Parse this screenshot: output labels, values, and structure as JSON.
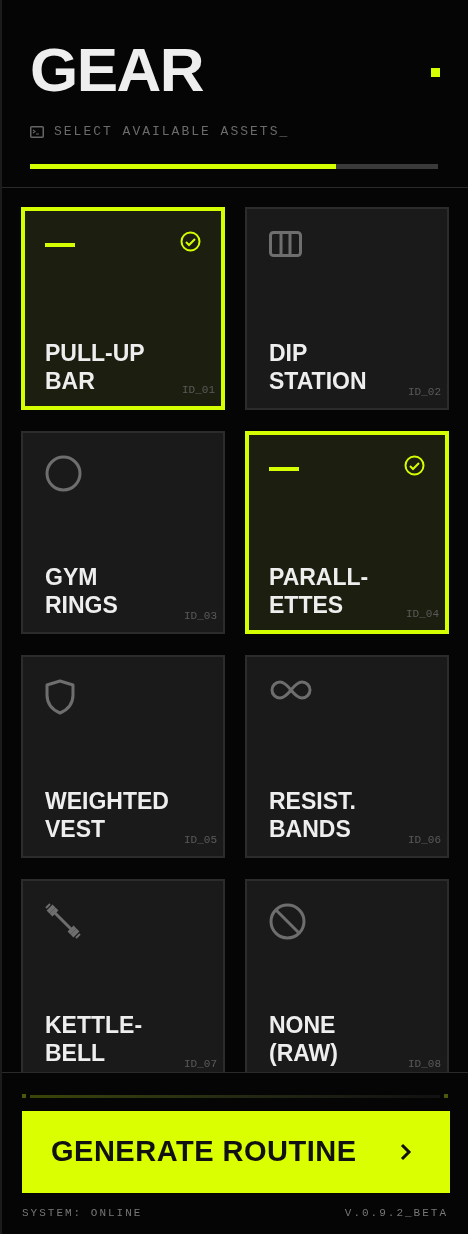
{
  "header": {
    "title": "GEAR",
    "subtitle": "SELECT AVAILABLE ASSETS_",
    "progress": {
      "level": 0.75
    }
  },
  "items": [
    {
      "label": "PULL-UP\nBAR",
      "id": "ID_01",
      "kind": "bar",
      "selected": true
    },
    {
      "label": "DIP\nSTATION",
      "id": "ID_02",
      "kind": "dip",
      "selected": false
    },
    {
      "label": "GYM\nRINGS",
      "id": "ID_03",
      "kind": "rings",
      "selected": false
    },
    {
      "label": "PARALL-\nETTES",
      "id": "ID_04",
      "kind": "bar",
      "selected": true
    },
    {
      "label": "WEIGHTED\nVEST",
      "id": "ID_05",
      "kind": "vest",
      "selected": false
    },
    {
      "label": "RESIST.\nBANDS",
      "id": "ID_06",
      "kind": "bands",
      "selected": false
    },
    {
      "label": "KETTLE-\nBELL",
      "id": "ID_07",
      "kind": "weight",
      "selected": false
    },
    {
      "label": "NONE\n(RAW)",
      "id": "ID_08",
      "kind": "none",
      "selected": false
    }
  ],
  "footer": {
    "button": "GENERATE ROUTINE",
    "status": "SYSTEM: ONLINE",
    "version": "V.0.9.2_BETA"
  }
}
